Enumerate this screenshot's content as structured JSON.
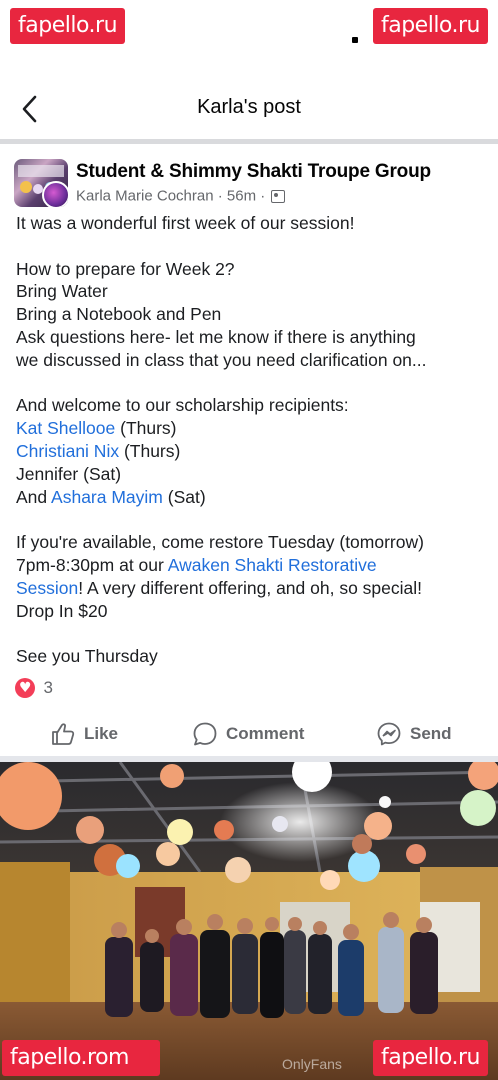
{
  "watermark": "fapello.ru",
  "watermark_bottom_left": "fapello.rom",
  "header": {
    "title": "Karla's post"
  },
  "post": {
    "group_name": "Student & Shimmy Shakti Troupe Group",
    "author": "Karla Marie Cochran",
    "separator": "·",
    "time": "56m",
    "lines": [
      "It was a wonderful first week of our session!",
      "",
      "How to prepare for Week 2?",
      "Bring Water",
      "Bring a Notebook and Pen",
      "Ask questions here- let me know if there is anything",
      "we discussed in class that you need clarification on...",
      "",
      "And welcome to our scholarship recipients:"
    ],
    "recipients": [
      {
        "name": "Kat Shellooe",
        "day": " (Thurs)"
      },
      {
        "name": "Christiani Nix",
        "day": " (Thurs)"
      },
      {
        "prefix": "Jennifer (Sat)"
      },
      {
        "prefix": "And ",
        "name": "Ashara Mayim",
        "day": " (Sat)"
      }
    ],
    "para3_line1": "If you're available, come restore Tuesday (tomorrow)",
    "para3_line2_pre": "7pm-8:30pm at our ",
    "para3_link1": "Awaken Shakti Restorative",
    "para3_link2": "Session",
    "para3_line3_post": "! A very different offering, and oh, so special!",
    "para3_line4": "Drop In $20",
    "closing": "See you Thursday",
    "reaction_count": "3"
  },
  "actions": {
    "like": "Like",
    "comment": "Comment",
    "send": "Send"
  },
  "photo_watermark": "OnlyFans",
  "colors": {
    "link": "#216fdb",
    "watermark_bg": "#e8263f",
    "heart": "#f33e58"
  }
}
